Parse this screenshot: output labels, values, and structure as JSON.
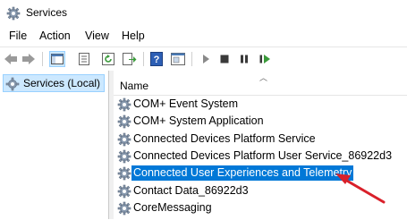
{
  "window": {
    "title": "Services"
  },
  "menu": [
    "File",
    "Action",
    "View",
    "Help"
  ],
  "toolbar": {
    "icons": [
      "back-arrow-icon",
      "forward-arrow-icon",
      "show-hide-console-tree-icon",
      "properties-icon",
      "refresh-icon",
      "export-list-icon",
      "help-icon",
      "console-icon",
      "start-service-icon",
      "stop-service-icon",
      "pause-service-icon",
      "restart-service-icon"
    ]
  },
  "tree": {
    "selected_label": "Services (Local)"
  },
  "list": {
    "column_name": "Name",
    "rows": [
      {
        "label": "COM+ Event System",
        "selected": false
      },
      {
        "label": "COM+ System Application",
        "selected": false
      },
      {
        "label": "Connected Devices Platform Service",
        "selected": false
      },
      {
        "label": "Connected Devices Platform User Service_86922d3",
        "selected": false
      },
      {
        "label": "Connected User Experiences and Telemetry",
        "selected": true
      },
      {
        "label": "Contact Data_86922d3",
        "selected": false
      },
      {
        "label": "CoreMessaging",
        "selected": false
      }
    ]
  },
  "annotation": {
    "arrow_color": "#d9202a"
  }
}
